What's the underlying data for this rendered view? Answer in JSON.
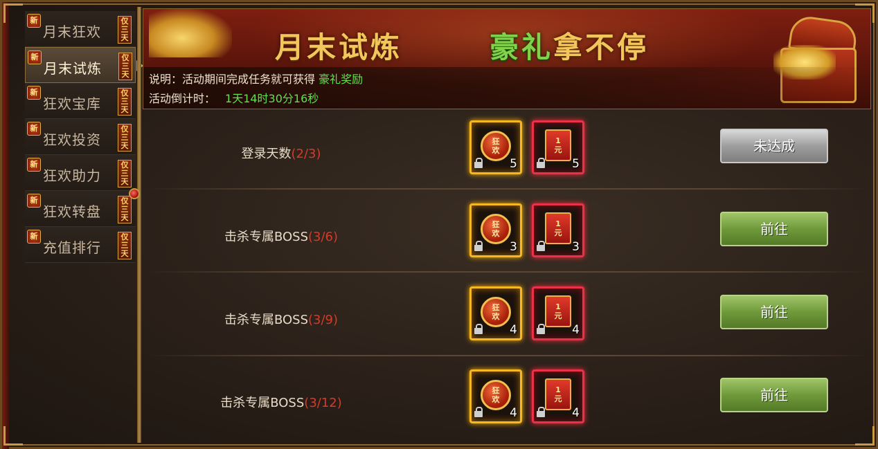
{
  "sidebar": {
    "new_badge": "新",
    "only_badge": "仅三天",
    "items": [
      {
        "label": "月末狂欢"
      },
      {
        "label": "月末试炼"
      },
      {
        "label": "狂欢宝库"
      },
      {
        "label": "狂欢投资"
      },
      {
        "label": "狂欢助力"
      },
      {
        "label": "狂欢转盘"
      },
      {
        "label": "充值排行"
      }
    ],
    "active_index": 1
  },
  "banner": {
    "title_part1": "月末试炼",
    "title_part2_green": "豪礼",
    "title_part2_rest": "拿不停",
    "desc_prefix": "说明：活动期间完成任务就可获得",
    "desc_highlight": "豪礼奖励",
    "countdown_label": "活动倒计时：",
    "countdown_value": "1天14时30分16秒"
  },
  "reward_labels": {
    "coin_text": "狂欢",
    "envelope_text": "1元"
  },
  "tasks": [
    {
      "name": "登录天数",
      "progress": "(2/3)",
      "coin_qty": "5",
      "envelope_qty": "5",
      "button": "未达成",
      "button_state": "disabled"
    },
    {
      "name": "击杀专属BOSS",
      "progress": "(3/6)",
      "coin_qty": "3",
      "envelope_qty": "3",
      "button": "前往",
      "button_state": "enabled"
    },
    {
      "name": "击杀专属BOSS",
      "progress": "(3/9)",
      "coin_qty": "4",
      "envelope_qty": "4",
      "button": "前往",
      "button_state": "enabled"
    },
    {
      "name": "击杀专属BOSS",
      "progress": "(3/12)",
      "coin_qty": "4",
      "envelope_qty": "4",
      "button": "前往",
      "button_state": "enabled"
    }
  ],
  "colors": {
    "gold_accent": "#f2c65a",
    "green_accent": "#5fe24a",
    "progress_red": "#d83a2a",
    "button_green": "#6f9a3a",
    "button_grey": "#9e9e9e"
  }
}
